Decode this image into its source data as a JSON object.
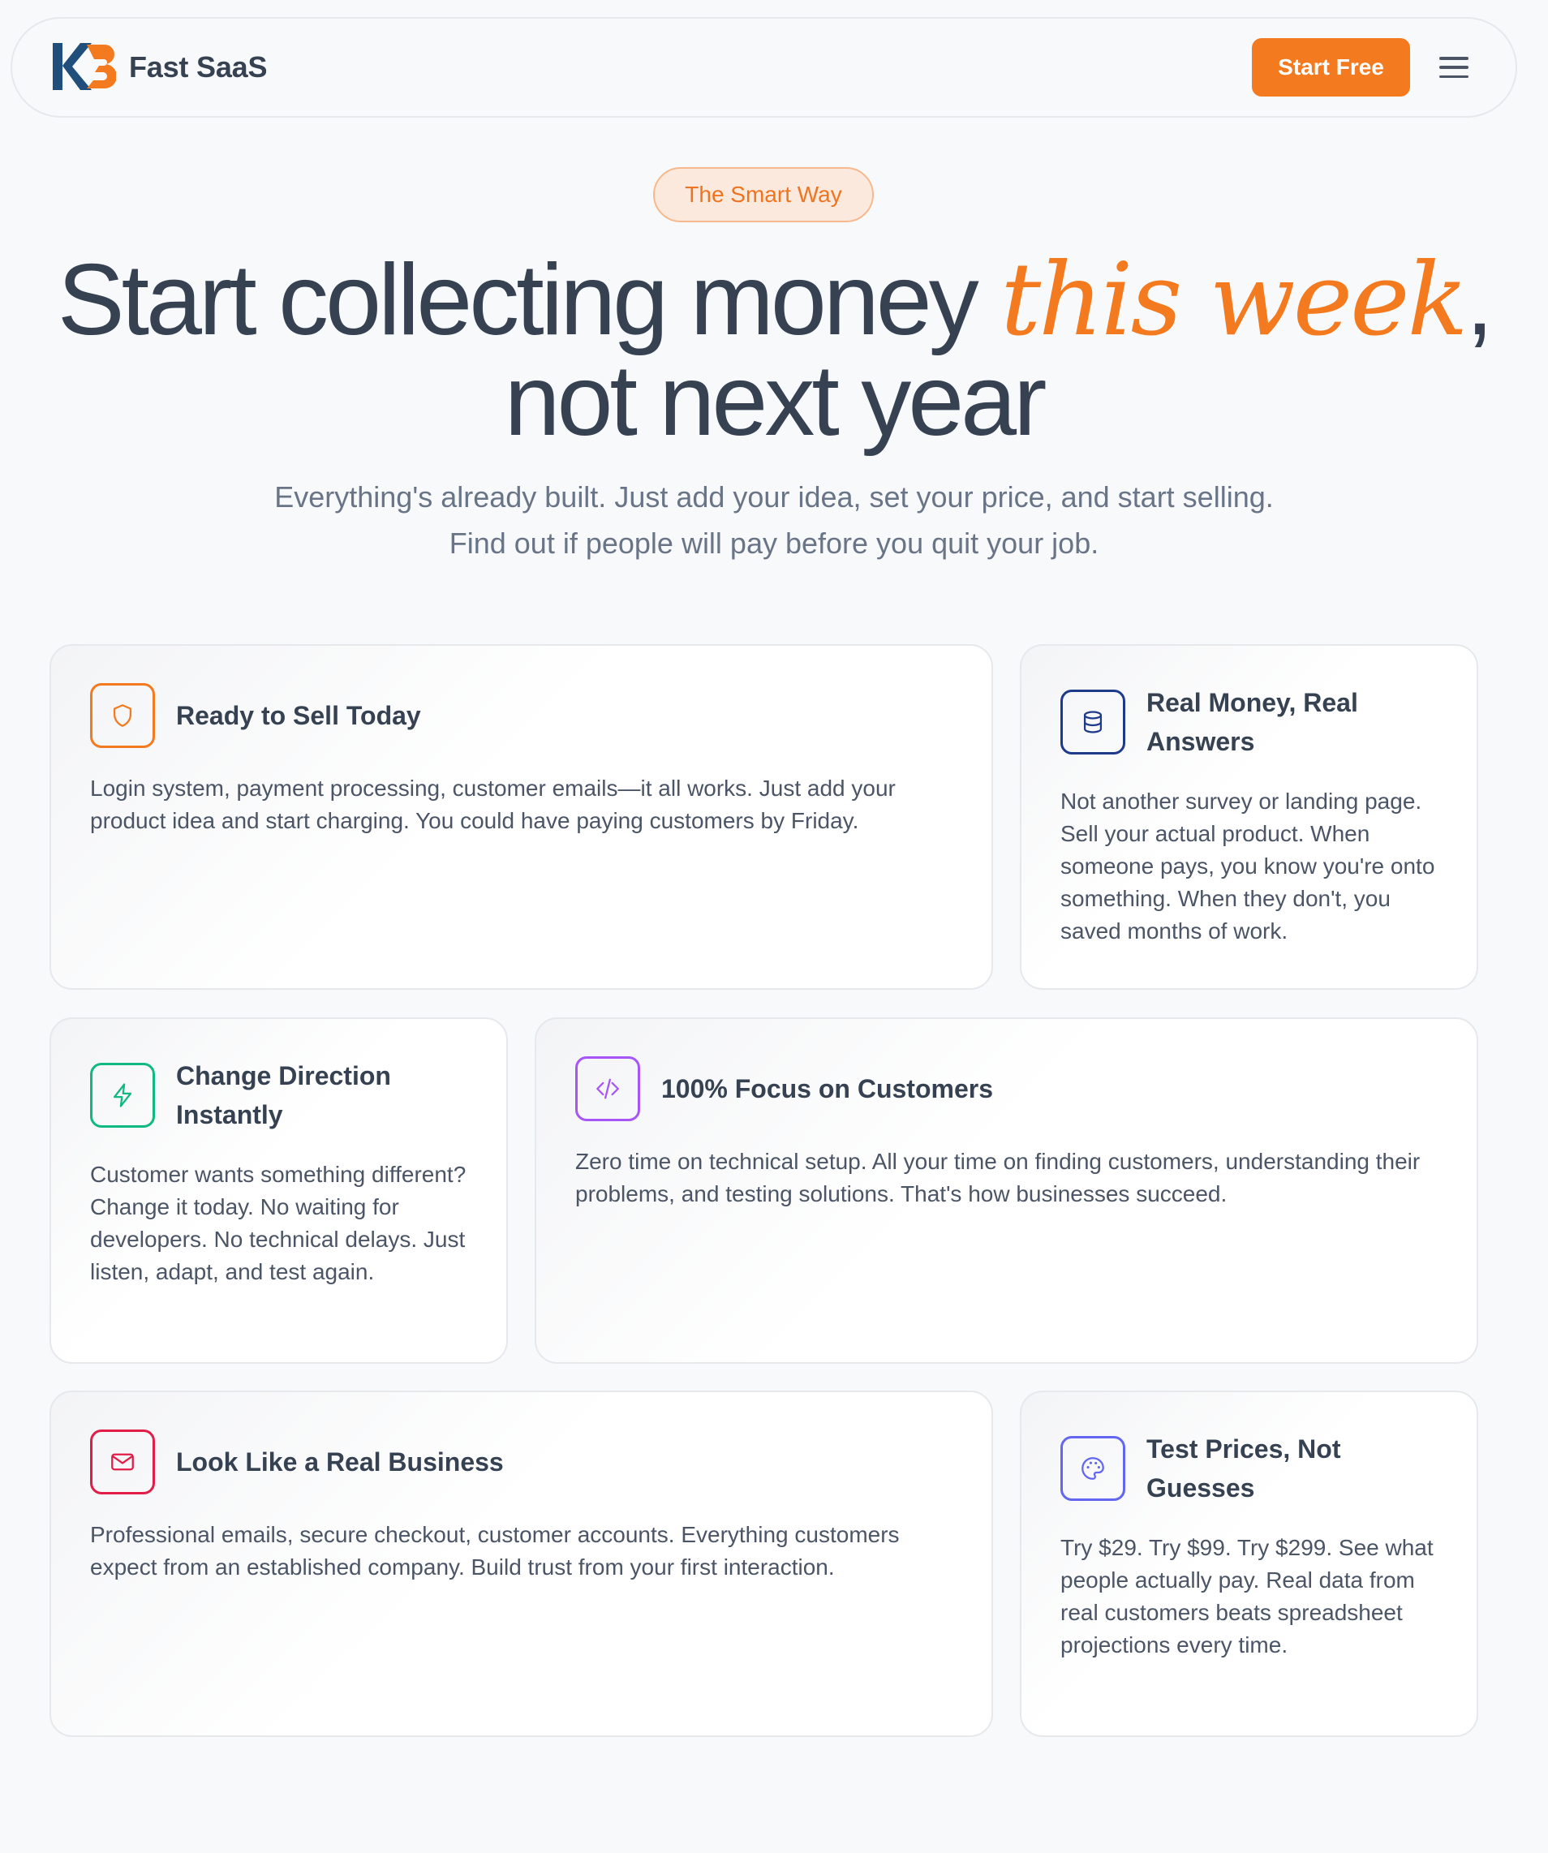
{
  "header": {
    "brand_name": "Fast SaaS",
    "logo_alt": "K3",
    "cta_label": "Start Free",
    "menu_icon": "hamburger-menu-icon"
  },
  "hero": {
    "badge": "The Smart Way",
    "title_before": "Start collecting money ",
    "title_accent": "this week",
    "title_after_line1": ",",
    "title_line2": "not next year",
    "subtitle_line1": "Everything's already built. Just add your idea, set your price, and start selling.",
    "subtitle_line2": "Find out if people will pay before you quit your job."
  },
  "features": [
    {
      "title": "Ready to Sell Today",
      "description": "Login system, payment processing, customer emails—it all works. Just add your product idea and start charging. You could have paying customers by Friday.",
      "icon": "shield-icon",
      "color": "#f47a1f"
    },
    {
      "title": "Real Money, Real Answers",
      "description": "Not another survey or landing page. Sell your actual product. When someone pays, you know you're onto something. When they don't, you saved months of work.",
      "icon": "database-icon",
      "color": "#1e3a8a"
    },
    {
      "title": "Change Direction Instantly",
      "description": "Customer wants something different? Change it today. No waiting for developers. No technical delays. Just listen, adapt, and test again.",
      "icon": "lightning-icon",
      "color": "#10b981"
    },
    {
      "title": "100% Focus on Customers",
      "description": "Zero time on technical setup. All your time on finding customers, understanding their problems, and testing solutions. That's how businesses succeed.",
      "icon": "code-icon",
      "color": "#a855f7"
    },
    {
      "title": "Look Like a Real Business",
      "description": "Professional emails, secure checkout, customer accounts. Everything customers expect from an established company. Build trust from your first interaction.",
      "icon": "mail-icon",
      "color": "#e11d48"
    },
    {
      "title": "Test Prices, Not Guesses",
      "description": "Try $29. Try $99. Try $299. See what people actually pay. Real data from real customers beats spreadsheet projections every time.",
      "icon": "palette-icon",
      "color": "#6366f1"
    }
  ]
}
